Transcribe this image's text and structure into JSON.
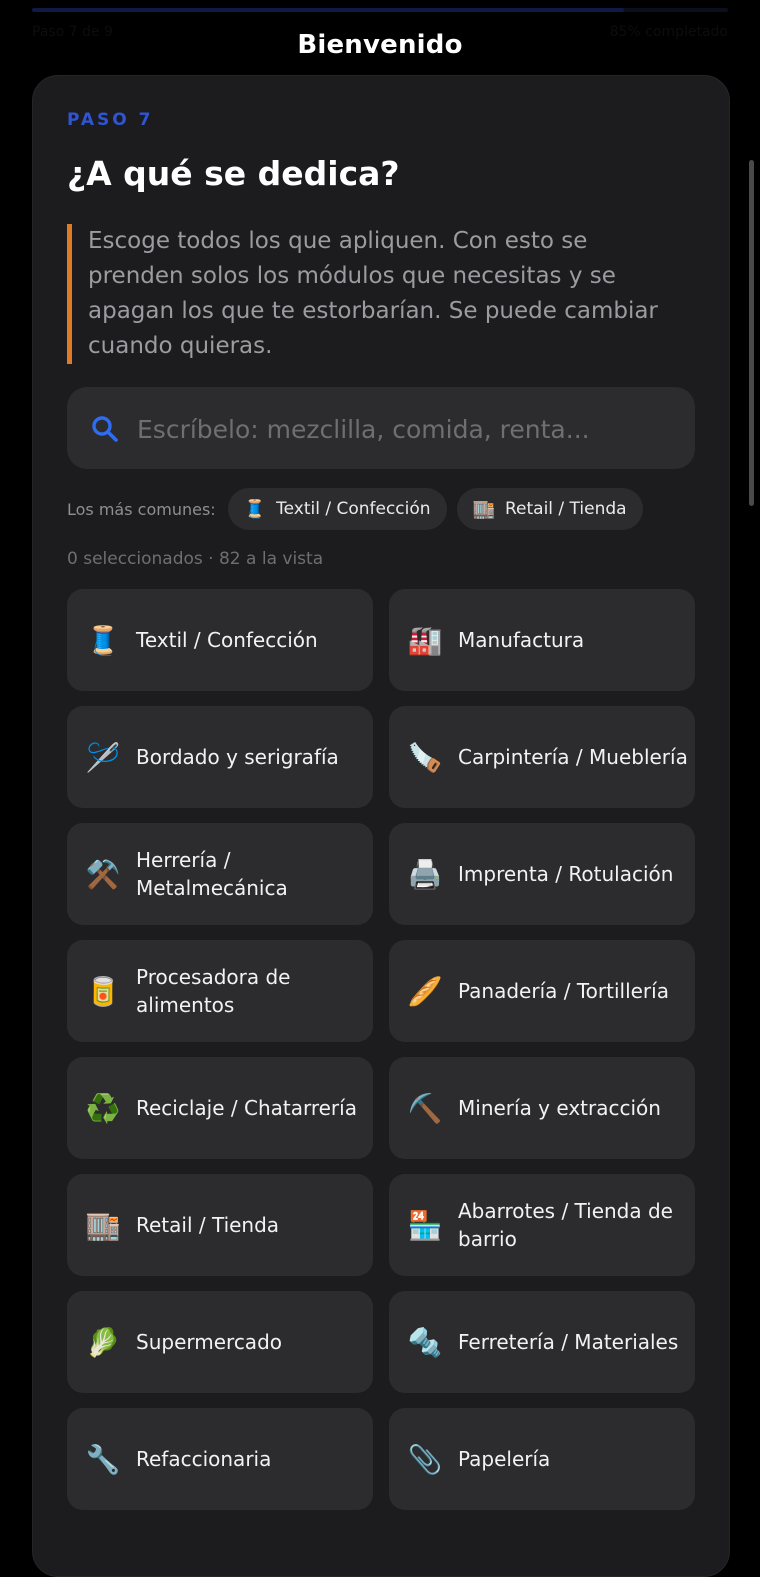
{
  "header": {
    "title": "Bienvenido",
    "progress": 0.85,
    "ghost_left": "Paso 7 de 9",
    "ghost_right": "85% completado"
  },
  "step": {
    "label": "PASO 7",
    "question": "¿A qué se dedica?",
    "hint": "Escoge todos los que apliquen. Con esto se prenden solos los módulos que necesitas y se apagan los que te estorbarían. Se puede cambiar cuando quieras."
  },
  "search": {
    "placeholder": "Escríbelo: mezclilla, comida, renta...",
    "value": ""
  },
  "common": {
    "label": "Los más comunes:",
    "chips": [
      {
        "icon": "🧵",
        "label": "Textil / Confección"
      },
      {
        "icon": "🏬",
        "label": "Retail / Tienda"
      }
    ]
  },
  "count": "0 seleccionados · 82 a la vista",
  "industries": [
    {
      "icon": "🧵",
      "label": "Textil / Confección"
    },
    {
      "icon": "🏭",
      "label": "Manufactura"
    },
    {
      "icon": "🪡",
      "label": "Bordado y serigrafía"
    },
    {
      "icon": "🪚",
      "label": "Carpintería / Mueblería"
    },
    {
      "icon": "⚒️",
      "label": "Herrería / Metalmecánica"
    },
    {
      "icon": "🖨️",
      "label": "Imprenta / Rotulación"
    },
    {
      "icon": "🥫",
      "label": "Procesadora de alimentos"
    },
    {
      "icon": "🥖",
      "label": "Panadería / Tortillería"
    },
    {
      "icon": "♻️",
      "label": "Reciclaje / Chatarrería"
    },
    {
      "icon": "⛏️",
      "label": "Minería y extracción"
    },
    {
      "icon": "🏬",
      "label": "Retail / Tienda"
    },
    {
      "icon": "🏪",
      "label": "Abarrotes / Tienda de barrio"
    },
    {
      "icon": "🥬",
      "label": "Supermercado"
    },
    {
      "icon": "🔩",
      "label": "Ferretería / Materiales"
    },
    {
      "icon": "🔧",
      "label": "Refaccionaria"
    },
    {
      "icon": "📎",
      "label": "Papelería"
    }
  ],
  "colors": {
    "accent": "#2f55d4",
    "hint_bar": "#e07a26",
    "card": "#1c1c1e",
    "tile": "#2c2c2e"
  }
}
